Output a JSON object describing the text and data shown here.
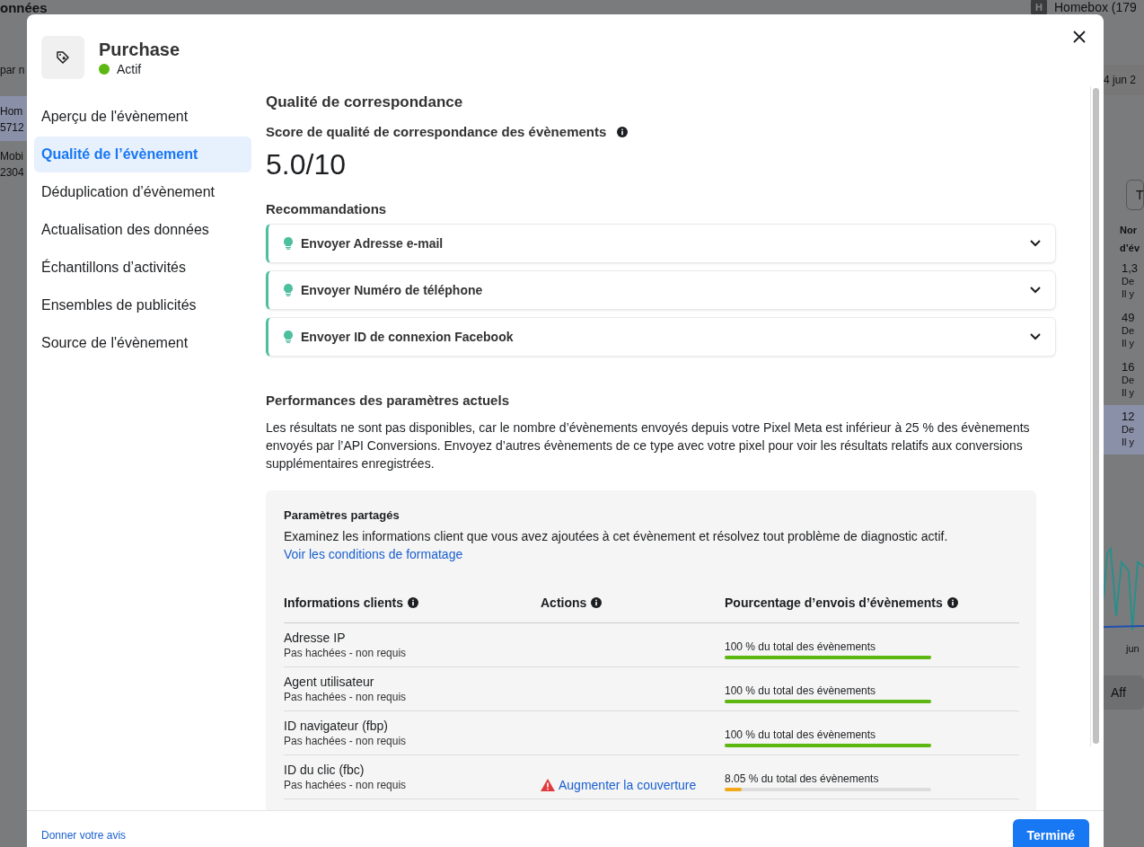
{
  "background": {
    "title": "onnées",
    "account": {
      "badge": "H",
      "name": "Homebox (179"
    },
    "search": "par n",
    "left_rows": [
      {
        "name": "Hom",
        "id": "5712",
        "selected": true
      },
      {
        "name": "Mobi",
        "id": "2304",
        "selected": false
      }
    ],
    "date": "4 jun 2",
    "filter_button": "T",
    "column_header": [
      "Nor",
      "d’év"
    ],
    "rows": [
      {
        "value": "1,3",
        "line_2": "De",
        "line_3": "Il y",
        "selected": false
      },
      {
        "value": "49",
        "line_2": "De",
        "line_3": "Il y",
        "selected": false
      },
      {
        "value": "16",
        "line_2": "De",
        "line_3": "Il y",
        "selected": false
      },
      {
        "value": "12",
        "line_2": "De",
        "line_3": "Il y",
        "selected": true
      }
    ],
    "chart_label": "jun",
    "button": "Aff"
  },
  "modal": {
    "event": {
      "name": "Purchase",
      "status": "Actif",
      "active": true
    },
    "nav": [
      {
        "label": "Aperçu de l'évènement",
        "selected": false
      },
      {
        "label": "Qualité de l’évènement",
        "selected": true
      },
      {
        "label": "Déduplication d’évènement",
        "selected": false
      },
      {
        "label": "Actualisation des données",
        "selected": false
      },
      {
        "label": "Échantillons d’activités",
        "selected": false
      },
      {
        "label": "Ensembles de publicités",
        "selected": false
      },
      {
        "label": "Source de l'évènement",
        "selected": false
      }
    ],
    "heading": "Qualité de correspondance",
    "score_label": "Score de qualité de correspondance des évènements",
    "score": "5.0/10",
    "recommendations_title": "Recommandations",
    "recommendations": [
      {
        "label": "Envoyer Adresse e-mail",
        "expanded": false
      },
      {
        "label": "Envoyer Numéro de téléphone",
        "expanded": false
      },
      {
        "label": "Envoyer ID de connexion Facebook",
        "expanded": false
      }
    ],
    "performance_title": "Performances des paramètres actuels",
    "performance_text": "Les résultats ne sont pas disponibles, car le nombre d’évènements envoyés depuis votre Pixel Meta est inférieur à 25 % des évènements envoyés par l’API Conversions. Envoyez d’autres évènements de ce type avec votre pixel pour voir les résultats relatifs aux conversions supplémentaires enregistrées.",
    "shared": {
      "title": "Paramètres partagés",
      "text": "Examinez les informations client que vous avez ajoutées à cet évènement et résolvez tout problème de diagnostic actif.",
      "link": "Voir les conditions de formatage",
      "columns": [
        "Informations clients",
        "Actions",
        "Pourcentage d’envois d’évènements"
      ],
      "rows": [
        {
          "name": "Adresse IP",
          "hashing": "Pas hachées - non requis",
          "percent": "100 % du total des évènements",
          "level": 1,
          "color": "#5cb811"
        },
        {
          "name": "Agent utilisateur",
          "hashing": "Pas hachées - non requis",
          "percent": "100 % du total des évènements",
          "level": 1,
          "color": "#5cb811"
        },
        {
          "name": "ID navigateur (fbp)",
          "hashing": "Pas hachées - non requis",
          "percent": "100 % du total des évènements",
          "level": 1,
          "color": "#5cb811"
        },
        {
          "name": "ID du clic (fbc)",
          "hashing": "Pas hachées - non requis",
          "action": {
            "kind": "warning",
            "label": "Augmenter la couverture"
          },
          "percent": "8.05 % du total des évènements",
          "level": 0.0805,
          "color": "#f2a918"
        }
      ]
    }
  },
  "footer": {
    "feedback": "Donner votre avis",
    "done": "Terminé"
  }
}
